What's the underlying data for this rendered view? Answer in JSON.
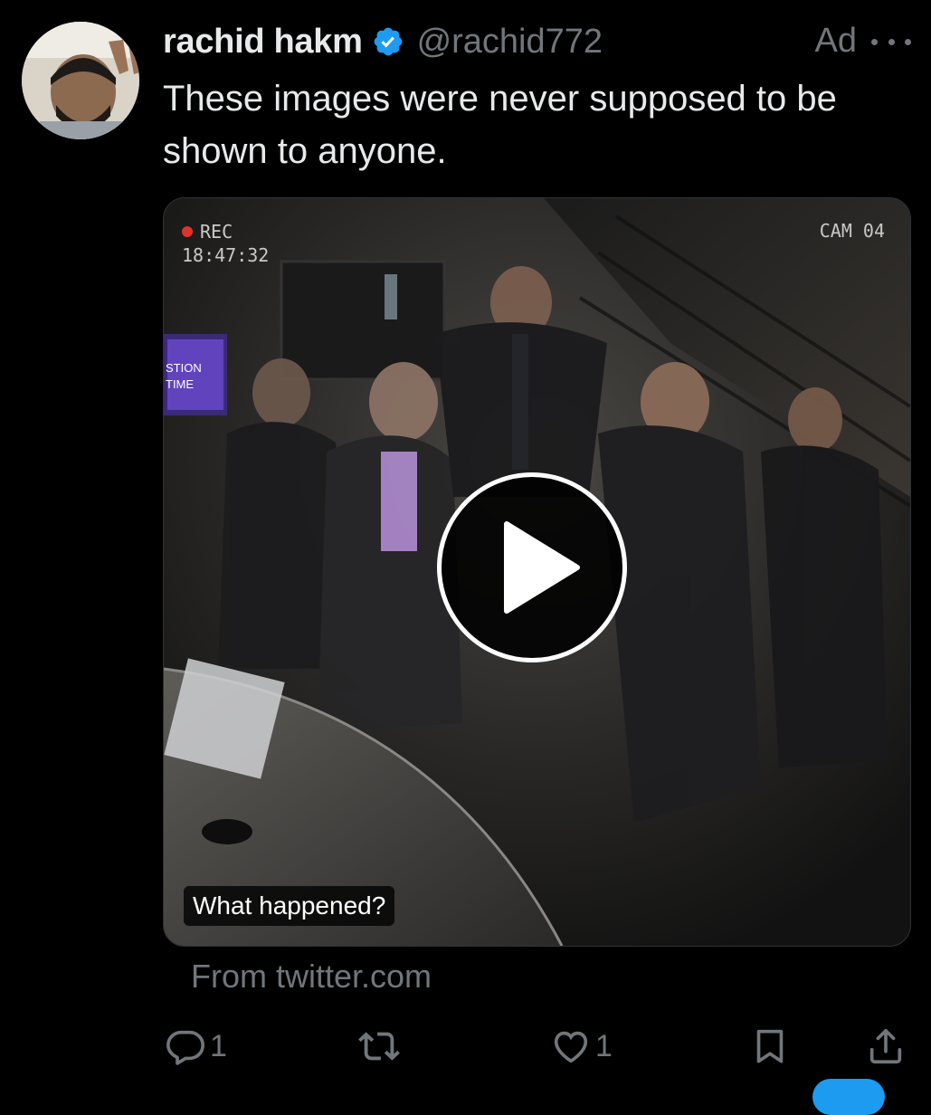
{
  "author": {
    "display_name": "rachid hakm",
    "handle": "@rachid772",
    "verified": true,
    "verified_icon": "verified-badge-icon",
    "verified_color": "#1d9bf0"
  },
  "ad_label": "Ad",
  "tweet": {
    "text": "These images were never supposed to be shown to anyone."
  },
  "media": {
    "rec_label": "REC",
    "timestamp": "18:47:32",
    "camera_label": "CAM 04",
    "studio_sign": "STION\nTIME",
    "caption": "What happened?",
    "play_icon": "play-icon"
  },
  "source": "From twitter.com",
  "actions": {
    "reply_count": "1",
    "like_count": "1",
    "icons": [
      "reply-icon",
      "retweet-icon",
      "like-icon",
      "bookmark-icon",
      "share-icon"
    ]
  },
  "colors": {
    "background": "#000000",
    "text_primary": "#e7e9ea",
    "text_secondary": "#71767b",
    "accent": "#1d9bf0",
    "rec_dot": "#e0322b"
  }
}
